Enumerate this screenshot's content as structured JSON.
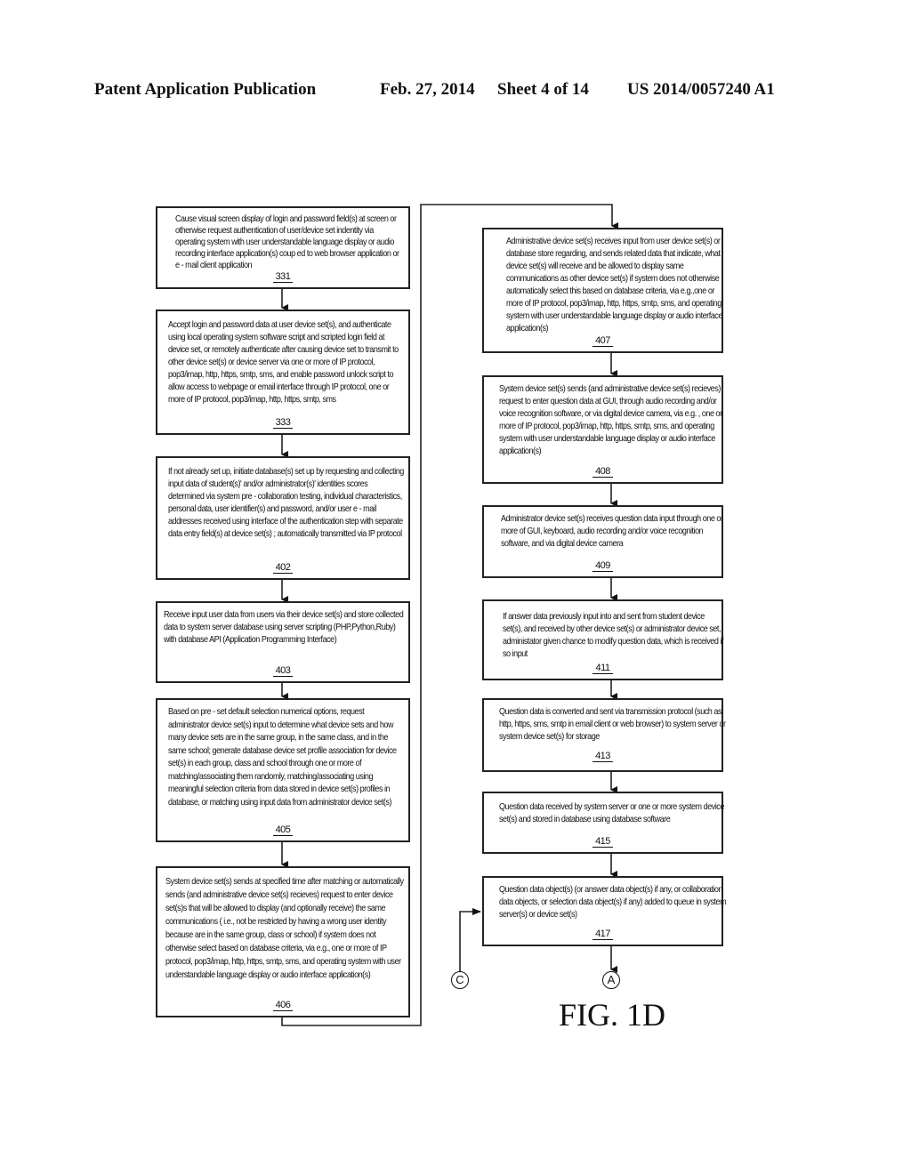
{
  "header": {
    "publication": "Patent Application Publication",
    "date": "Feb. 27, 2014",
    "sheet": "Sheet 4 of 14",
    "number": "US 2014/0057240 A1"
  },
  "figure_label": "FIG. 1D",
  "connectors": {
    "C": "C",
    "A": "A"
  },
  "left_column": [
    {
      "ref": "331",
      "text": "Cause visual screen display of login and password field(s) at screen or otherwise request authentication of user/device set indentity via operating system with user understandable language display or audio recording interface application(s) coup ed to web browser application or e - mail client application"
    },
    {
      "ref": "333",
      "text": "Accept login and password data at user device set(s), and authenticate using local operating system software script and scripted login field at device set, or remotely authenticate after causing device set to transmit to other device set(s) or device server via one or more of IP protocol, pop3/imap, http, https, smtp, sms, and enable password unlock script to allow access to webpage or email interface through IP protocol, one or more of IP protocol, pop3/imap, http, https, smtp, sms"
    },
    {
      "ref": "402",
      "text": "If not already set up, initiate database(s) set up by requesting and collecting input data of student(s)' and/or administrator(s)' identities scores determined via system pre - collaboration testing, individual characteristics, personal data, user identifier(s) and password, and/or user e - mail addresses received using interface of the authentication step with separate data entry field(s) at device set(s) ; automatically transmitted via IP protocol"
    },
    {
      "ref": "403",
      "text": "Receive input user data from users via their device set(s) and store collected data to system server database using server scripting (PHP,Python,Ruby) with database API (Application Programming Interface)"
    },
    {
      "ref": "405",
      "text": "Based on pre - set default selection numerical options, request administrator device set(s) input to determine what device sets and how many device sets are in the same group, in the same class, and in the same school; generate database device set profile association for device set(s) in each group, class and school through one or more of matching/associating them randomly, matching/associating using meaningful selection criteria from data stored in device set(s) profiles in database, or matching using input data from administrator device set(s)"
    },
    {
      "ref": "406",
      "text": "System device set(s) sends at specified time after matching or automatically sends (and administrative device set(s) recieves) request to enter device set(s)s that will be allowed to display (and optionally receive) the same communications ( i.e., not be restricted by having a wrong user identity because are in the same group, class or school) if system does not otherwise select based on database criteria, via e.g., one or more of IP protocol, pop3/imap, http, https, smtp, sms, and operating system with user understandable language display or audio interface application(s)"
    }
  ],
  "right_column": [
    {
      "ref": "407",
      "text": "Administrative device set(s) receives input from user device set(s) or database store regarding, and sends related data that indicate, what device set(s) will receive and be allowed to display same communications as other device set(s) if system does not otherwise automatically select this based on database criteria, via e.g.,one or more of IP protocol, pop3/imap, http, https, smtp, sms, and operating system with user understandable language display or audio interface application(s)"
    },
    {
      "ref": "408",
      "text": "System device set(s) sends (and administrative device set(s) recieves) request to enter question data at GUI, through audio recording and/or voice recognition software, or via digital device camera, via e.g. , one or more of IP protocol, pop3/imap, http, https, smtp, sms, and operating system with user understandable language display or audio interface application(s)"
    },
    {
      "ref": "409",
      "text": "Administrator device set(s) receives question data input through one or more of GUI, keyboard, audio recording and/or voice recognition software, and via digital device camera"
    },
    {
      "ref": "411",
      "text": "If answer data previously input into and sent from student device set(s), and received by other device set(s) or administrator device set, administator given chance to modify question data, which is received if so input"
    },
    {
      "ref": "413",
      "text": "Question data is converted and sent via transmission protocol (such as http, https, sms, smtp in email client or web browser) to system server or system device set(s) for storage"
    },
    {
      "ref": "415",
      "text": "Question data received by system server or one or more system device set(s) and stored in database using database software"
    },
    {
      "ref": "417",
      "text": "Question data object(s) (or answer data object(s) if any, or collaboration data objects, or selection data object(s) if any) added to queue in system server(s) or device set(s)"
    }
  ]
}
